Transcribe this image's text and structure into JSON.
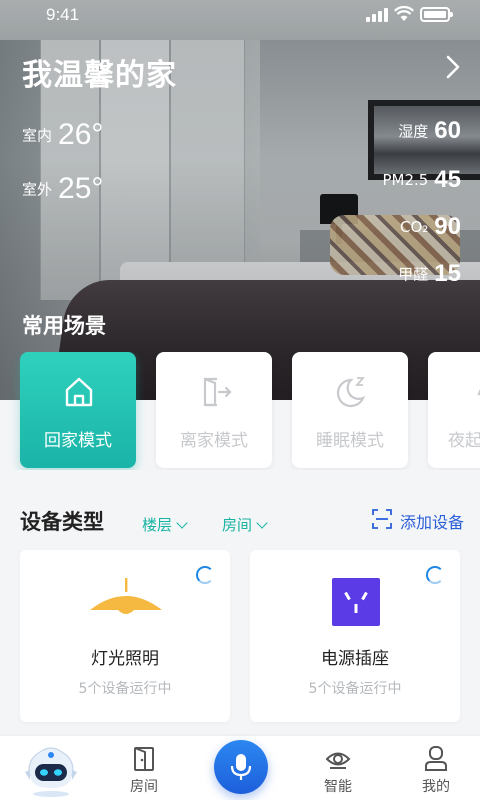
{
  "status_bar": {
    "time": "9:41"
  },
  "home": {
    "title": "我温馨的家",
    "indoor_label": "室内",
    "indoor_temp": "26°",
    "outdoor_label": "室外",
    "outdoor_temp": "25°",
    "humidity_label": "湿度",
    "humidity_value": "60",
    "pm25_label": "PM2.5",
    "pm25_value": "45",
    "co2_label": "CO₂",
    "co2_value": "90",
    "formaldehyde_label": "甲醛",
    "formaldehyde_value": "15"
  },
  "scenes": {
    "title": "常用场景",
    "items": [
      {
        "label": "回家模式",
        "icon": "home-icon",
        "active": true
      },
      {
        "label": "离家模式",
        "icon": "exit-door-icon",
        "active": false
      },
      {
        "label": "睡眠模式",
        "icon": "moon-sleep-icon",
        "active": false
      },
      {
        "label": "夜起",
        "icon": "night-lamp-icon",
        "active": false
      }
    ]
  },
  "devices": {
    "title": "设备类型",
    "filter_floor": "楼层",
    "filter_room": "房间",
    "add_label": "添加设备",
    "cards": [
      {
        "name": "灯光照明",
        "status": "5个设备运行中",
        "icon": "pendant-lamp-icon"
      },
      {
        "name": "电源插座",
        "status": "5个设备运行中",
        "icon": "power-socket-icon"
      }
    ]
  },
  "nav": {
    "items": [
      "房间",
      "智能",
      "我的"
    ]
  },
  "colors": {
    "accent_teal": "#1ab4a8",
    "accent_blue": "#2b5fd8",
    "lamp_yellow": "#f5b942",
    "socket_purple": "#5b3be6"
  }
}
